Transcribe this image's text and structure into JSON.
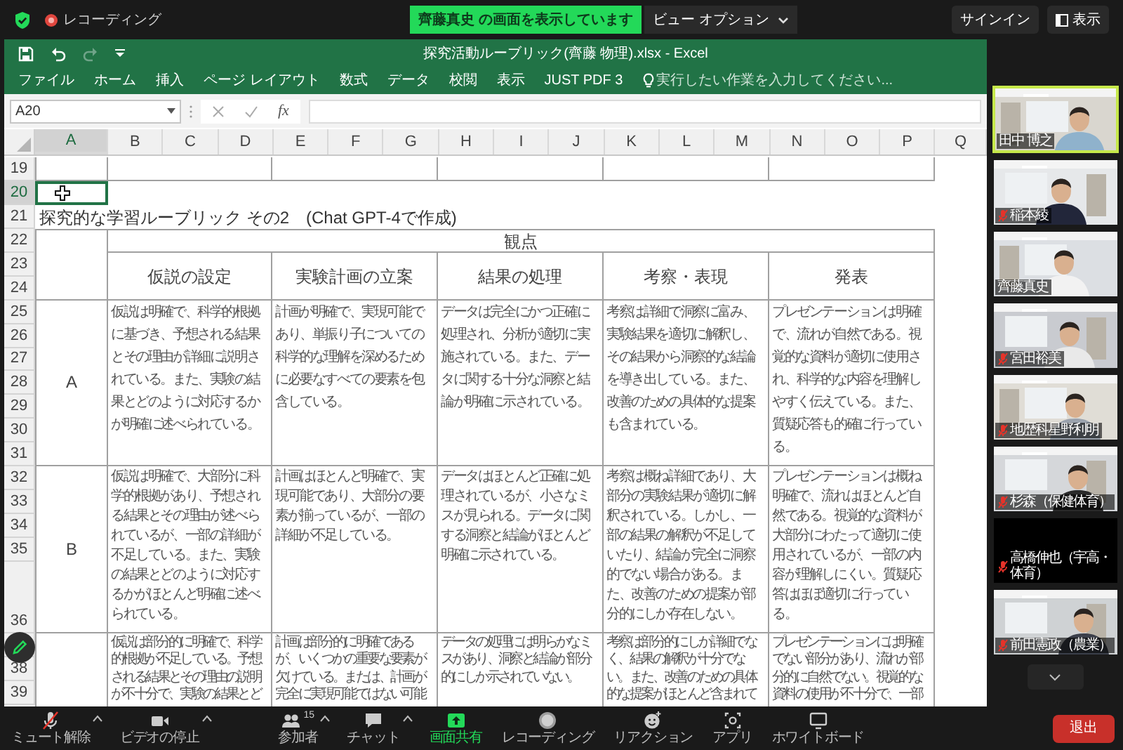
{
  "zoom_top": {
    "recording_label": "レコーディング",
    "share_banner": "齊藤真史 の画面を表示しています",
    "view_options": "ビュー オプション",
    "sign_in": "サインイン",
    "view": "表示"
  },
  "excel": {
    "title": "探究活動ルーブリック(齊藤 物理).xlsx - Excel",
    "ribbon_tabs": [
      "ファイル",
      "ホーム",
      "挿入",
      "ページ レイアウト",
      "数式",
      "データ",
      "校閲",
      "表示",
      "JUST PDF 3"
    ],
    "tell_me": "実行したい作業を入力してください...",
    "name_box": "A20",
    "fx": "fx",
    "columns": [
      {
        "label": "A",
        "selected": true
      },
      {
        "label": "B",
        "selected": false
      },
      {
        "label": "C",
        "selected": false
      },
      {
        "label": "D",
        "selected": false
      },
      {
        "label": "E",
        "selected": false
      },
      {
        "label": "F",
        "selected": false
      },
      {
        "label": "G",
        "selected": false
      },
      {
        "label": "H",
        "selected": false
      },
      {
        "label": "I",
        "selected": false
      },
      {
        "label": "J",
        "selected": false
      },
      {
        "label": "K",
        "selected": false
      },
      {
        "label": "L",
        "selected": false
      },
      {
        "label": "M",
        "selected": false
      },
      {
        "label": "N",
        "selected": false
      },
      {
        "label": "O",
        "selected": false
      },
      {
        "label": "P",
        "selected": false
      },
      {
        "label": "Q",
        "selected": false
      }
    ],
    "rows": [
      {
        "label": "19",
        "selected": false
      },
      {
        "label": "20",
        "selected": true
      },
      {
        "label": "21",
        "selected": false
      },
      {
        "label": "22",
        "selected": false
      },
      {
        "label": "23",
        "selected": false
      },
      {
        "label": "24",
        "selected": false
      },
      {
        "label": "25",
        "selected": false
      },
      {
        "label": "26",
        "selected": false
      },
      {
        "label": "27",
        "selected": false
      },
      {
        "label": "28",
        "selected": false
      },
      {
        "label": "29",
        "selected": false
      },
      {
        "label": "30",
        "selected": false
      },
      {
        "label": "31",
        "selected": false
      },
      {
        "label": "32",
        "selected": false
      },
      {
        "label": "33",
        "selected": false
      },
      {
        "label": "34",
        "selected": false
      },
      {
        "label": "35",
        "selected": false
      },
      {
        "label": "36",
        "selected": false
      },
      {
        "selected": false
      },
      {
        "label": "38",
        "selected": false
      },
      {
        "label": "39",
        "selected": false
      }
    ],
    "sheet": {
      "title": "探究的な学習ルーブリック その2　(Chat GPT-4で作成)",
      "group_header": "観点",
      "criteria": [
        "仮説の設定",
        "実験計画の立案",
        "結果の処理",
        "考察・表現",
        "発表"
      ],
      "levels": [
        {
          "grade": "A",
          "cells": [
            "仮説は明確で、科学的根拠に基づき、予想される結果とその理由が詳細に説明されている。また、実験の結果とどのように対応するかが明確に述べられている。",
            "計画が明確で、実現可能であり、単振り子についての科学的な理解を深めるために必要なすべての要素を包含している。",
            "データは完全にかつ正確に処理され、分析が適切に実施されている。また、データに関する十分な洞察と結論が明確に示されている。",
            "考察は詳細で洞察に富み、実験結果を適切に解釈し、その結果から洞察的な結論を導き出している。また、改善のための具体的な提案も含まれている。",
            "プレゼンテーションは明確で、流れが自然である。視覚的な資料が適切に使用され、科学的な内容を理解しやすく伝えている。また、質疑応答も的確に行っている。"
          ]
        },
        {
          "grade": "B",
          "cells": [
            "仮説は明確で、大部分に科学的根拠があり、予想される結果とその理由が述べられているが、一部の詳細が不足している。また、実験の結果とどのように対応するかがほとんど明確に述べられている。",
            "計画はほとんど明確で、実現可能であり、大部分の要素が揃っているが、一部の詳細が不足している。",
            "データはほとんど正確に処理されているが、小さなミスが見られる。データに関する洞察と結論がほとんど明確に示されている。",
            "考察は概ね詳細であり、大部分の実験結果が適切に解釈されている。しかし、一部の結果の解釈が不足していたり、結論が完全に洞察的でない場合がある。また、改善のための提案が部分的にしか存在しない。",
            "プレゼンテーションは概ね明確で、流れはほとんど自然である。視覚的な資料が大部分にわたって適切に使用されているが、一部の内容が理解しにくい。質疑応答はほぼ適切に行っている。"
          ]
        },
        {
          "cells": [
            "仮説は部分的に明確で、科学的根拠が不足している。予想される結果とその理由の説明が不十分で、実験の結果とど",
            "計画は部分的に明確であるが、いくつかの重要な要素が欠けている。または、計画が完全に実現可能ではない可能",
            "データの処理には明らかなミスがあり、洞察と結論が部分的にしか示されていない。",
            "考察は部分的にしか詳細でなく、結果の解釈が十分でない。また、改善のための具体的な提案がほとんど含まれて",
            "プレゼンテーションには明確でない部分があり、流れが部分的に自然でない。視覚的な資料の使用が不十分で、一部"
          ]
        }
      ]
    }
  },
  "participants": [
    {
      "name": "田中 博之",
      "muted": false,
      "active": true,
      "video": true
    },
    {
      "name": "稲本綾",
      "muted": true,
      "active": false,
      "video": true
    },
    {
      "name": "齊藤真史",
      "muted": false,
      "active": false,
      "video": true
    },
    {
      "name": "宮田裕美",
      "muted": true,
      "active": false,
      "video": true
    },
    {
      "name": "地歴科星野利明",
      "muted": true,
      "active": false,
      "video": true
    },
    {
      "name": "杉森（保健体育）",
      "muted": true,
      "active": false,
      "video": true
    },
    {
      "name": "高橋伸也（宇高・体育）",
      "muted": true,
      "active": false,
      "video": false
    },
    {
      "name": "前田憲政（農業）",
      "muted": true,
      "active": false,
      "video": true
    }
  ],
  "toolbar": [
    {
      "kind": "mic-muted",
      "label": "ミュート解除",
      "caret": true,
      "active": false
    },
    {
      "kind": "video",
      "label": "ビデオの停止",
      "caret": true,
      "active": false
    },
    {
      "kind": "participants",
      "label": "参加者",
      "count": "15",
      "caret": true,
      "active": false
    },
    {
      "kind": "chat",
      "label": "チャット",
      "caret": true,
      "active": false
    },
    {
      "kind": "share",
      "label": "画面共有",
      "caret": false,
      "active": true
    },
    {
      "kind": "record",
      "label": "レコーディング",
      "caret": false,
      "active": false
    },
    {
      "kind": "reaction",
      "label": "リアクション",
      "caret": false,
      "active": false
    },
    {
      "kind": "apps",
      "label": "アプリ",
      "caret": false,
      "active": false
    },
    {
      "kind": "whiteboard",
      "label": "ホワイトボード",
      "caret": false,
      "active": false
    }
  ],
  "leave": "退出"
}
